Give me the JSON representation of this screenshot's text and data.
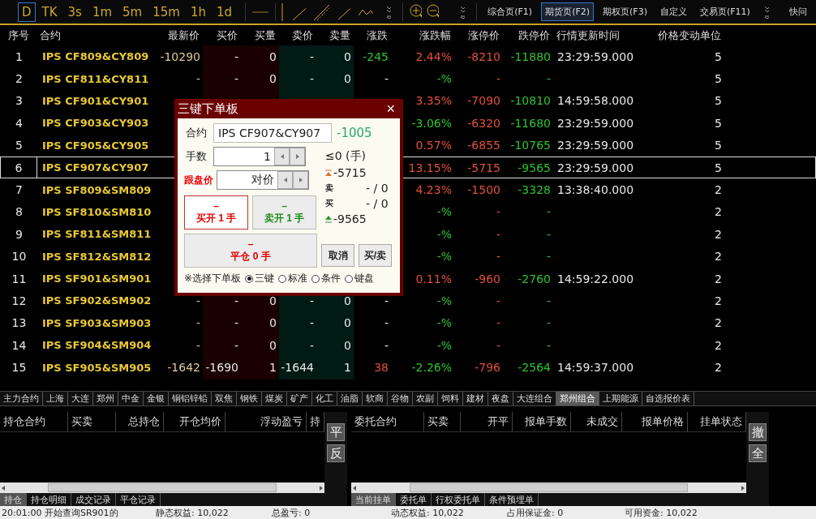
{
  "toolbar": {
    "periods": [
      {
        "label": "D",
        "selected": true
      },
      {
        "label": "TK",
        "selected": false
      },
      {
        "label": "3s",
        "selected": false
      },
      {
        "label": "1m",
        "selected": false
      },
      {
        "label": "5m",
        "selected": false
      },
      {
        "label": "15m",
        "selected": false
      },
      {
        "label": "1h",
        "selected": false
      },
      {
        "label": "1d",
        "selected": false
      }
    ],
    "pages": [
      {
        "label": "综合页(F1)",
        "selected": false
      },
      {
        "label": "期货页(F2)",
        "selected": true
      },
      {
        "label": "期权页(F3)",
        "selected": false
      },
      {
        "label": "自定义",
        "selected": false
      },
      {
        "label": "交易页(F11)",
        "selected": false
      }
    ],
    "ask": "快问"
  },
  "table": {
    "columns": [
      "序号",
      "合约",
      "最新价",
      "买价",
      "买量",
      "卖价",
      "卖量",
      "涨跌",
      "涨跌幅",
      "涨停价",
      "跌停价",
      "行情更新时间",
      "价格变动单位"
    ],
    "rows": [
      {
        "selected": false,
        "cells": [
          "1",
          "IPS CF809&CY809",
          "-10290",
          "-",
          "0",
          "-",
          "0",
          {
            "text": "-245",
            "color": "#2fc22f"
          },
          {
            "text": "2.44%",
            "color": "#e0503c"
          },
          "-8210",
          "-11880",
          "23:29:59.000",
          "5"
        ]
      },
      {
        "selected": false,
        "cells": [
          "2",
          "IPS CF811&CY811",
          "-",
          "-",
          "0",
          "-",
          "0",
          {
            "text": "-",
            "color": "#e8e8e8"
          },
          {
            "text": "-%",
            "color": "#2fc22f"
          },
          "-",
          "-",
          "",
          "5"
        ]
      },
      {
        "selected": false,
        "cells": [
          "3",
          "IPS CF901&CY901",
          null,
          null,
          null,
          null,
          null,
          null,
          {
            "text": "3.35%",
            "color": "#e0503c"
          },
          "-7090",
          "-10810",
          "14:59:58.000",
          "5"
        ]
      },
      {
        "selected": false,
        "cells": [
          "4",
          "IPS CF903&CY903",
          null,
          null,
          null,
          null,
          null,
          null,
          {
            "text": "-3.06%",
            "color": "#2fc22f"
          },
          "-6320",
          "-11680",
          "23:29:59.000",
          "5"
        ]
      },
      {
        "selected": false,
        "cells": [
          "5",
          "IPS CF905&CY905",
          null,
          null,
          null,
          null,
          null,
          null,
          {
            "text": "0.57%",
            "color": "#e0503c"
          },
          "-6855",
          "-10765",
          "23:29:59.000",
          "5"
        ]
      },
      {
        "selected": true,
        "cells": [
          "6",
          "IPS CF907&CY907",
          null,
          null,
          null,
          null,
          null,
          null,
          {
            "text": "13.15%",
            "color": "#e0503c"
          },
          "-5715",
          "-9565",
          "23:29:59.000",
          "5"
        ]
      },
      {
        "selected": false,
        "cells": [
          "7",
          "IPS SF809&SM809",
          null,
          null,
          null,
          null,
          null,
          null,
          {
            "text": "4.23%",
            "color": "#e0503c"
          },
          "-1500",
          "-3328",
          "13:38:40.000",
          "2"
        ]
      },
      {
        "selected": false,
        "cells": [
          "8",
          "IPS SF810&SM810",
          null,
          null,
          null,
          null,
          null,
          null,
          {
            "text": "-%",
            "color": "#2fc22f"
          },
          "-",
          "-",
          "",
          "2"
        ]
      },
      {
        "selected": false,
        "cells": [
          "9",
          "IPS SF811&SM811",
          null,
          null,
          null,
          null,
          null,
          null,
          {
            "text": "-%",
            "color": "#2fc22f"
          },
          "-",
          "-",
          "",
          "2"
        ]
      },
      {
        "selected": false,
        "cells": [
          "10",
          "IPS SF812&SM812",
          null,
          null,
          null,
          null,
          null,
          null,
          {
            "text": "-%",
            "color": "#2fc22f"
          },
          "-",
          "-",
          "",
          "2"
        ]
      },
      {
        "selected": false,
        "cells": [
          "11",
          "IPS SF901&SM901",
          null,
          null,
          null,
          null,
          null,
          null,
          {
            "text": "0.11%",
            "color": "#e0503c"
          },
          "-960",
          "-2760",
          "14:59:22.000",
          "2"
        ]
      },
      {
        "selected": false,
        "cells": [
          "12",
          "IPS SF902&SM902",
          "-",
          "-",
          "0",
          "-",
          "0",
          {
            "text": "-",
            "color": "#e8e8e8"
          },
          {
            "text": "-%",
            "color": "#2fc22f"
          },
          "-",
          "-",
          "",
          "2"
        ]
      },
      {
        "selected": false,
        "cells": [
          "13",
          "IPS SF903&SM903",
          "-",
          "-",
          "0",
          "-",
          "0",
          {
            "text": "-",
            "color": "#e8e8e8"
          },
          {
            "text": "-%",
            "color": "#2fc22f"
          },
          "-",
          "-",
          "",
          "2"
        ]
      },
      {
        "selected": false,
        "cells": [
          "14",
          "IPS SF904&SM904",
          "-",
          "-",
          "0",
          "-",
          "0",
          {
            "text": "-",
            "color": "#e8e8e8"
          },
          {
            "text": "-%",
            "color": "#2fc22f"
          },
          "-",
          "-",
          "",
          "2"
        ]
      },
      {
        "selected": false,
        "cells": [
          "15",
          "IPS SF905&SM905",
          "-1642",
          "-1690",
          "1",
          "-1644",
          "1",
          {
            "text": "38",
            "color": "#e0503c"
          },
          {
            "text": "-2.26%",
            "color": "#2fc22f"
          },
          "-796",
          "-2564",
          "14:59:37.000",
          "2"
        ]
      }
    ]
  },
  "market_tabs": [
    {
      "label": "主力合约",
      "selected": false
    },
    {
      "label": "上海",
      "selected": false
    },
    {
      "label": "大连",
      "selected": false
    },
    {
      "label": "郑州",
      "selected": false
    },
    {
      "label": "中金",
      "selected": false
    },
    {
      "label": "金银",
      "selected": false
    },
    {
      "label": "铜铝锌铅",
      "selected": false
    },
    {
      "label": "双焦",
      "selected": false
    },
    {
      "label": "钢铁",
      "selected": false
    },
    {
      "label": "煤炭",
      "selected": false
    },
    {
      "label": "矿产",
      "selected": false
    },
    {
      "label": "化工",
      "selected": false
    },
    {
      "label": "油脂",
      "selected": false
    },
    {
      "label": "软商",
      "selected": false
    },
    {
      "label": "谷物",
      "selected": false
    },
    {
      "label": "农副",
      "selected": false
    },
    {
      "label": "饲料",
      "selected": false
    },
    {
      "label": "建材",
      "selected": false
    },
    {
      "label": "夜盘",
      "selected": false
    },
    {
      "label": "大连组合",
      "selected": false
    },
    {
      "label": "郑州组合",
      "selected": true
    },
    {
      "label": "上期能源",
      "selected": false
    },
    {
      "label": "自选报价表",
      "selected": false
    }
  ],
  "positions": {
    "columns": [
      "持仓合约",
      "买卖",
      "总持仓",
      "开仓均价",
      "浮动盈亏",
      "持"
    ],
    "side_buttons": [
      "平",
      "反"
    ],
    "tabs": [
      {
        "label": "持仓",
        "selected": true
      },
      {
        "label": "持仓明细",
        "selected": false
      },
      {
        "label": "成交记录",
        "selected": false
      },
      {
        "label": "平仓记录",
        "selected": false
      }
    ]
  },
  "orders": {
    "columns": [
      "委托合约",
      "买卖",
      "开平",
      "报单手数",
      "未成交",
      "报单价格",
      "挂单状态"
    ],
    "side_buttons": [
      "撤",
      "全"
    ],
    "tabs": [
      {
        "label": "当前挂单",
        "selected": true
      },
      {
        "label": "委托单",
        "selected": false
      },
      {
        "label": "行权委托单",
        "selected": false
      },
      {
        "label": "条件预埋单",
        "selected": false
      }
    ]
  },
  "status_bar": [
    "20:01:00 开始查询SR901的",
    "静态权益: 10,022",
    "总盈亏: 0",
    "动态权益: 10,022",
    "占用保证金: 0",
    "可用资金: 10,022"
  ],
  "dialog": {
    "title": "三键下单板",
    "close": "×",
    "contract_label": "合约",
    "contract_value": "IPS CF907&CY907",
    "contract_change": "-1005",
    "qty_label": "手数",
    "qty_value": "1",
    "price_label": "跟盘价",
    "price_value": "对价",
    "limit": "≤0 (手)",
    "upper": "-5715",
    "ask_label": "卖",
    "ask": "- / 0",
    "bid_label": "买",
    "bid": "- / 0",
    "lower": "-9565",
    "buy": {
      "price": "–",
      "label": "买开 1 手"
    },
    "sell": {
      "price": "–",
      "label": "卖开 1 手"
    },
    "close_pos": {
      "price": "–",
      "label": "平仓 0 手"
    },
    "cancel": "取消",
    "buy_sell": "买/卖",
    "panel_label": "※选择下单板",
    "panels": [
      {
        "label": "三键",
        "selected": true
      },
      {
        "label": "标准",
        "selected": false
      },
      {
        "label": "条件",
        "selected": false
      },
      {
        "label": "键盘",
        "selected": false
      }
    ]
  }
}
